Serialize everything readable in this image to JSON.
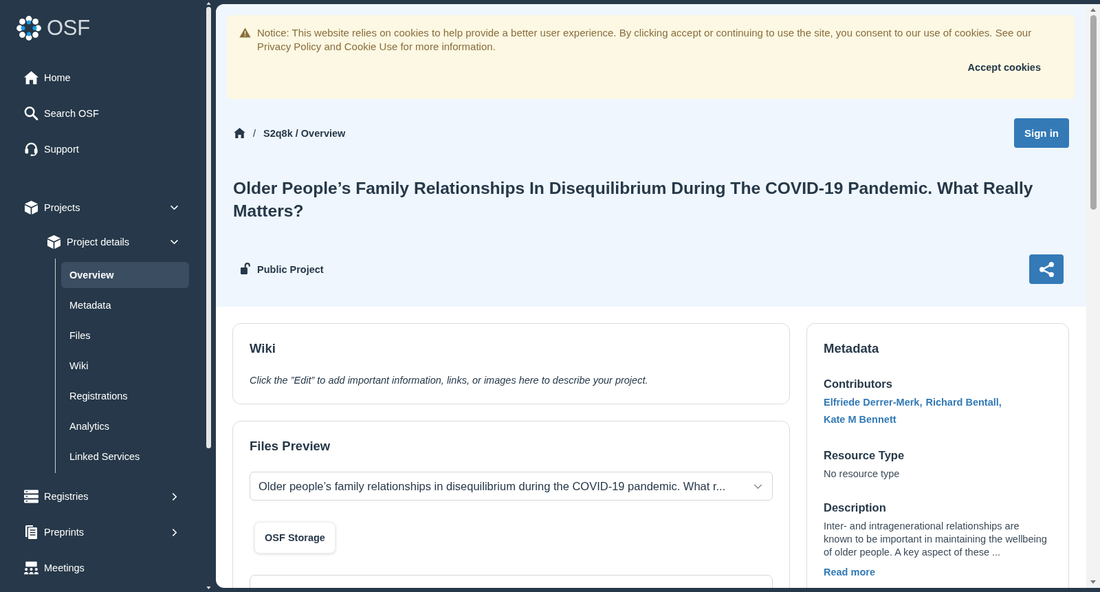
{
  "sidebar": {
    "logo": "OSF",
    "links": [
      {
        "label": "Home"
      },
      {
        "label": "Search OSF"
      },
      {
        "label": "Support"
      }
    ],
    "sections": [
      {
        "kind": "group",
        "label": "Projects",
        "expanded": true,
        "children": [
          {
            "label": "Project details",
            "expanded": true,
            "children": [
              {
                "label": "Overview",
                "selected": true
              },
              {
                "label": "Metadata",
                "selected": false
              },
              {
                "label": "Files",
                "selected": false
              },
              {
                "label": "Wiki",
                "selected": false
              },
              {
                "label": "Registrations",
                "selected": false
              },
              {
                "label": "Analytics",
                "selected": false
              },
              {
                "label": "Linked Services",
                "selected": false
              }
            ]
          }
        ]
      },
      {
        "kind": "group",
        "label": "Registries",
        "expanded": false
      },
      {
        "kind": "group",
        "label": "Preprints",
        "expanded": false
      },
      {
        "kind": "link",
        "label": "Meetings"
      }
    ]
  },
  "cookie_notice": {
    "text": "Notice: This website relies on cookies to help provide a better user experience. By clicking accept or continuing to use the site, you consent to our use of cookies. See our Privacy Policy and Cookie Use for more information.",
    "button": "Accept cookies"
  },
  "breadcrumb": {
    "separator": "/",
    "current": "S2q8k / Overview"
  },
  "sign_in": "Sign in",
  "title": "Older People’s Family Relationships In Disequilibrium During The COVID-19 Pandemic. What Really Matters?",
  "visibility": "Public Project",
  "wiki": {
    "title": "Wiki",
    "text": "Click the ”Edit” to add important information, links, or images here to describe your project."
  },
  "files_preview": {
    "title": "Files Preview",
    "selected_file": "Older people’s family relationships in disequilibrium during the COVID-19 pandemic. What r...",
    "storage_button": "OSF Storage"
  },
  "metadata": {
    "title": "Metadata",
    "sections": [
      {
        "kind": "links",
        "heading": "Contributors",
        "links": [
          "Elfriede Derrer-Merk,",
          "Richard Bentall,",
          "Kate M Bennett"
        ]
      },
      {
        "kind": "text",
        "heading": "Resource Type",
        "text": "No resource type"
      },
      {
        "kind": "text",
        "heading": "Description",
        "text": "Inter- and intragenerational relationships are known to be important in maintaining the wellbeing of older people. A key aspect of these ...",
        "link": "Read more"
      }
    ]
  }
}
